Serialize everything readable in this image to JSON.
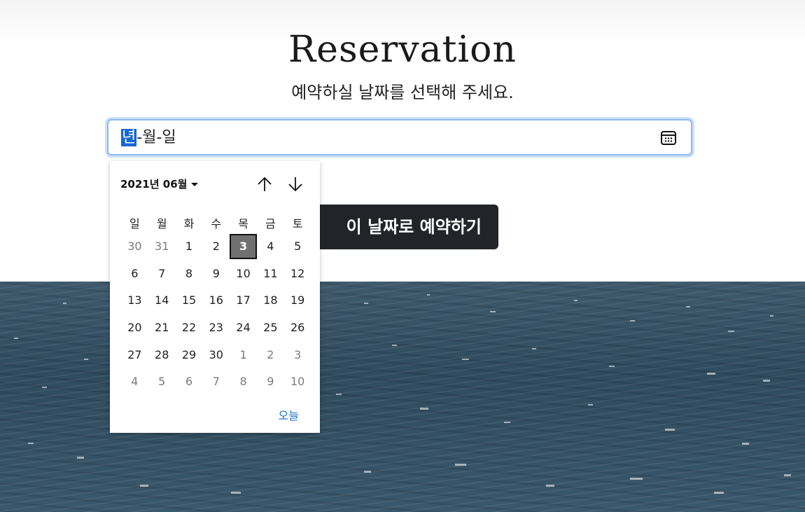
{
  "page": {
    "title": "Reservation",
    "subtitle": "예약하실 날짜를 선택해 주세요."
  },
  "date_input": {
    "year_segment": "년",
    "separator": "-",
    "month_segment": "월",
    "day_segment": "일",
    "icon": "calendar-icon"
  },
  "reserve_button": {
    "label": "이 날짜로 예약하기"
  },
  "calendar": {
    "month_label": "2021년 06월",
    "weekdays": [
      "일",
      "월",
      "화",
      "수",
      "목",
      "금",
      "토"
    ],
    "weeks": [
      [
        "30",
        "31",
        "1",
        "2",
        "3",
        "4",
        "5"
      ],
      [
        "6",
        "7",
        "8",
        "9",
        "10",
        "11",
        "12"
      ],
      [
        "13",
        "14",
        "15",
        "16",
        "17",
        "18",
        "19"
      ],
      [
        "20",
        "21",
        "22",
        "23",
        "24",
        "25",
        "26"
      ],
      [
        "27",
        "28",
        "29",
        "30",
        "1",
        "2",
        "3"
      ],
      [
        "4",
        "5",
        "6",
        "7",
        "8",
        "9",
        "10"
      ]
    ],
    "selected_day": "3",
    "today_label": "오늘",
    "nav_up_icon": "arrow-up-icon",
    "nav_down_icon": "arrow-down-icon"
  },
  "colors": {
    "selection_blue": "#1766d4",
    "button_dark": "#212529",
    "selected_day_bg": "#707070",
    "today_link": "#1a73c9",
    "sea": "#3a566a"
  }
}
